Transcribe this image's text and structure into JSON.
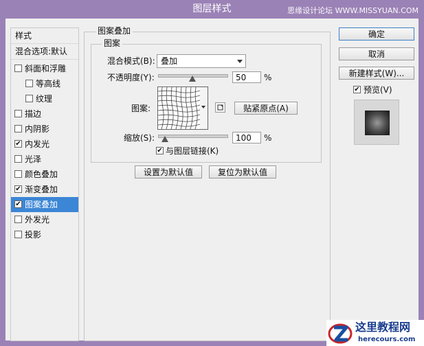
{
  "window": {
    "title": "图层样式",
    "watermark": "思缘设计论坛 WWW.MISSYUAN.COM"
  },
  "left_list": {
    "header": "样式",
    "blend": "混合选项:默认",
    "items": [
      {
        "label": "斜面和浮雕",
        "checked": false
      },
      {
        "label": "等高线",
        "checked": false
      },
      {
        "label": "纹理",
        "checked": false
      },
      {
        "label": "描边",
        "checked": false
      },
      {
        "label": "内阴影",
        "checked": false
      },
      {
        "label": "内发光",
        "checked": true
      },
      {
        "label": "光泽",
        "checked": false
      },
      {
        "label": "颜色叠加",
        "checked": false
      },
      {
        "label": "渐变叠加",
        "checked": true
      },
      {
        "label": "图案叠加",
        "checked": true
      },
      {
        "label": "外发光",
        "checked": false
      },
      {
        "label": "投影",
        "checked": false
      }
    ]
  },
  "panel": {
    "group_title": "图案叠加",
    "sub_title": "图案",
    "blend_mode_label": "混合模式(B):",
    "blend_mode_value": "叠加",
    "opacity_label": "不透明度(Y):",
    "opacity_value": "50",
    "opacity_unit": "%",
    "opacity_level": 0.5,
    "pattern_label": "图案:",
    "snap_button": "贴紧原点(A)",
    "scale_label": "缩放(S):",
    "scale_value": "100",
    "scale_unit": "%",
    "scale_level": 0.1,
    "link_label": "与图层链接(K)",
    "link_checked": true,
    "set_default": "设置为默认值",
    "reset_default": "复位为默认值"
  },
  "right": {
    "ok": "确定",
    "cancel": "取消",
    "new_style": "新建样式(W)...",
    "preview_label": "预览(V)",
    "preview_checked": true
  },
  "logo": {
    "title": "这里教程网",
    "url": "herecours.com"
  }
}
